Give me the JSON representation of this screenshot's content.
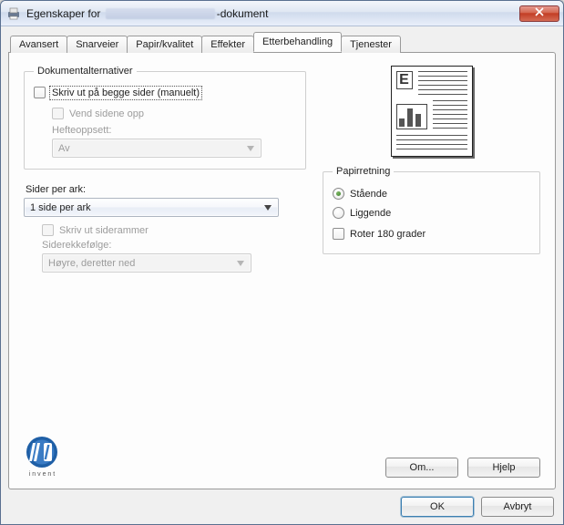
{
  "window": {
    "title_prefix": "Egenskaper for ",
    "title_suffix": "-dokument",
    "close_icon": "close-icon"
  },
  "tabs": {
    "avansert": "Avansert",
    "snarveier": "Snarveier",
    "papir": "Papir/kvalitet",
    "effekter": "Effekter",
    "etterbehandling": "Etterbehandling",
    "tjenester": "Tjenester",
    "active": "etterbehandling"
  },
  "doc_options": {
    "legend": "Dokumentalternativer",
    "duplex": {
      "label": "Skriv ut på begge sider (manuelt)",
      "checked": false
    },
    "flip": {
      "label": "Vend sidene opp",
      "checked": false,
      "enabled": false
    },
    "booklet_label": "Hefteoppsett:",
    "booklet_value": "Av",
    "booklet_enabled": false
  },
  "pages_per_sheet": {
    "label": "Sider per ark:",
    "value": "1 side per ark",
    "frames": {
      "label": "Skriv ut siderammer",
      "checked": false,
      "enabled": false
    },
    "order_label": "Siderekkefølge:",
    "order_value": "Høyre, deretter ned",
    "order_enabled": false
  },
  "orientation": {
    "legend": "Papirretning",
    "portrait": "Stående",
    "landscape": "Liggende",
    "selected": "portrait",
    "rotate": {
      "label": "Roter 180 grader",
      "checked": false
    }
  },
  "buttons": {
    "about": "Om...",
    "help": "Hjelp",
    "ok": "OK",
    "cancel": "Avbryt"
  },
  "logo": {
    "brand": "hp",
    "tag": "invent"
  }
}
